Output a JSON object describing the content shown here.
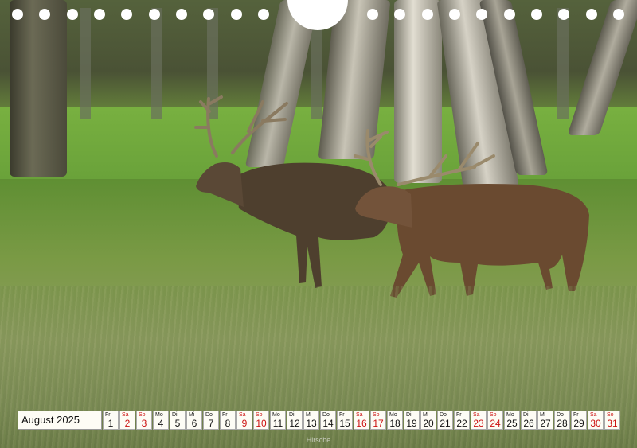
{
  "colors": {
    "weekend_red": "#cc1111",
    "cell_background": "#fdfcf5",
    "text": "#111111"
  },
  "calendar": {
    "month_label": "August 2025",
    "days": [
      {
        "dow": "Fr",
        "num": "1",
        "weekend": false
      },
      {
        "dow": "Sa",
        "num": "2",
        "weekend": true
      },
      {
        "dow": "So",
        "num": "3",
        "weekend": true
      },
      {
        "dow": "Mo",
        "num": "4",
        "weekend": false
      },
      {
        "dow": "Di",
        "num": "5",
        "weekend": false
      },
      {
        "dow": "Mi",
        "num": "6",
        "weekend": false
      },
      {
        "dow": "Do",
        "num": "7",
        "weekend": false
      },
      {
        "dow": "Fr",
        "num": "8",
        "weekend": false
      },
      {
        "dow": "Sa",
        "num": "9",
        "weekend": true
      },
      {
        "dow": "So",
        "num": "10",
        "weekend": true
      },
      {
        "dow": "Mo",
        "num": "11",
        "weekend": false
      },
      {
        "dow": "Di",
        "num": "12",
        "weekend": false
      },
      {
        "dow": "Mi",
        "num": "13",
        "weekend": false
      },
      {
        "dow": "Do",
        "num": "14",
        "weekend": false
      },
      {
        "dow": "Fr",
        "num": "15",
        "weekend": false
      },
      {
        "dow": "Sa",
        "num": "16",
        "weekend": true
      },
      {
        "dow": "So",
        "num": "17",
        "weekend": true
      },
      {
        "dow": "Mo",
        "num": "18",
        "weekend": false
      },
      {
        "dow": "Di",
        "num": "19",
        "weekend": false
      },
      {
        "dow": "Mi",
        "num": "20",
        "weekend": false
      },
      {
        "dow": "Do",
        "num": "21",
        "weekend": false
      },
      {
        "dow": "Fr",
        "num": "22",
        "weekend": false
      },
      {
        "dow": "Sa",
        "num": "23",
        "weekend": true
      },
      {
        "dow": "So",
        "num": "24",
        "weekend": true
      },
      {
        "dow": "Mo",
        "num": "25",
        "weekend": false
      },
      {
        "dow": "Di",
        "num": "26",
        "weekend": false
      },
      {
        "dow": "Mi",
        "num": "27",
        "weekend": false
      },
      {
        "dow": "Do",
        "num": "28",
        "weekend": false
      },
      {
        "dow": "Fr",
        "num": "29",
        "weekend": false
      },
      {
        "dow": "Sa",
        "num": "30",
        "weekend": true
      },
      {
        "dow": "So",
        "num": "31",
        "weekend": true
      }
    ]
  },
  "caption": "Hirsche"
}
